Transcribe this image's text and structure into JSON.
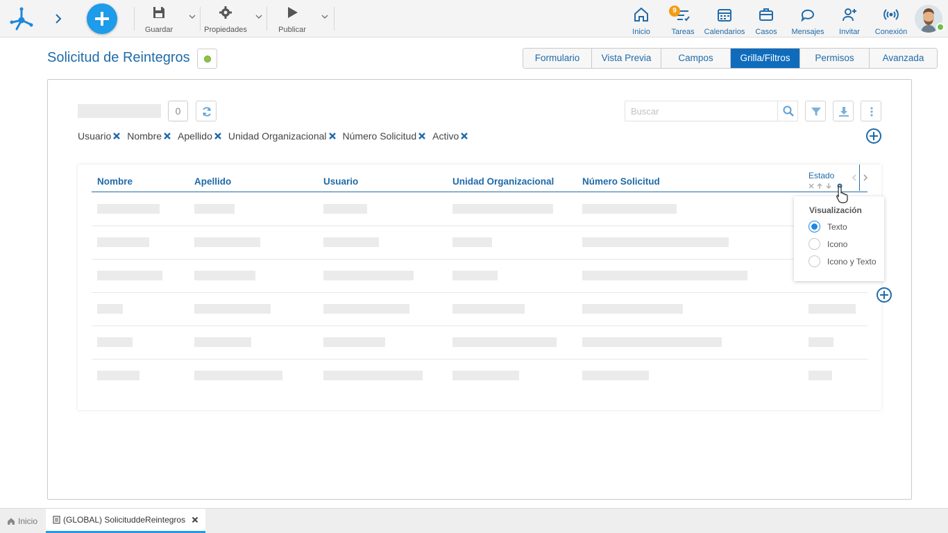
{
  "toolbar": {
    "save_label": "Guardar",
    "properties_label": "Propiedades",
    "publish_label": "Publicar"
  },
  "nav": {
    "home_label": "Inicio",
    "tasks_label": "Tareas",
    "tasks_badge": "9",
    "calendars_label": "Calendarios",
    "cases_label": "Casos",
    "messages_label": "Mensajes",
    "invite_label": "Invitar",
    "connection_label": "Conexión"
  },
  "page": {
    "title": "Solicitud de Reintegros",
    "status_color": "#8cc63f"
  },
  "tabs": [
    {
      "label": "Formulario"
    },
    {
      "label": "Vista Previa"
    },
    {
      "label": "Campos"
    },
    {
      "label": "Grilla/Filtros",
      "active": true
    },
    {
      "label": "Permisos"
    },
    {
      "label": "Avanzada"
    }
  ],
  "grid_toolbar": {
    "count": "0",
    "search_placeholder": "Buscar"
  },
  "filter_chips": [
    "Usuario",
    "Nombre",
    "Apellido",
    "Unidad Organizacional",
    "Número Solicitud",
    "Activo"
  ],
  "grid": {
    "columns": [
      "Nombre",
      "Apellido",
      "Usuario",
      "Unidad Organizacional",
      "Número Solicitud"
    ],
    "estado_column": "Estado"
  },
  "visualization_popup": {
    "title": "Visualización",
    "options": [
      "Texto",
      "Icono",
      "Icono y Texto"
    ],
    "selected": "Texto"
  },
  "bottom_tabs": {
    "home_label": "Inicio",
    "doc_label": "(GLOBAL) SolicituddeReintegros"
  },
  "colors": {
    "accent": "#1f6aa8",
    "fab": "#1e9be9",
    "active_tab": "#0f6cbd",
    "badge": "#f39c12"
  }
}
